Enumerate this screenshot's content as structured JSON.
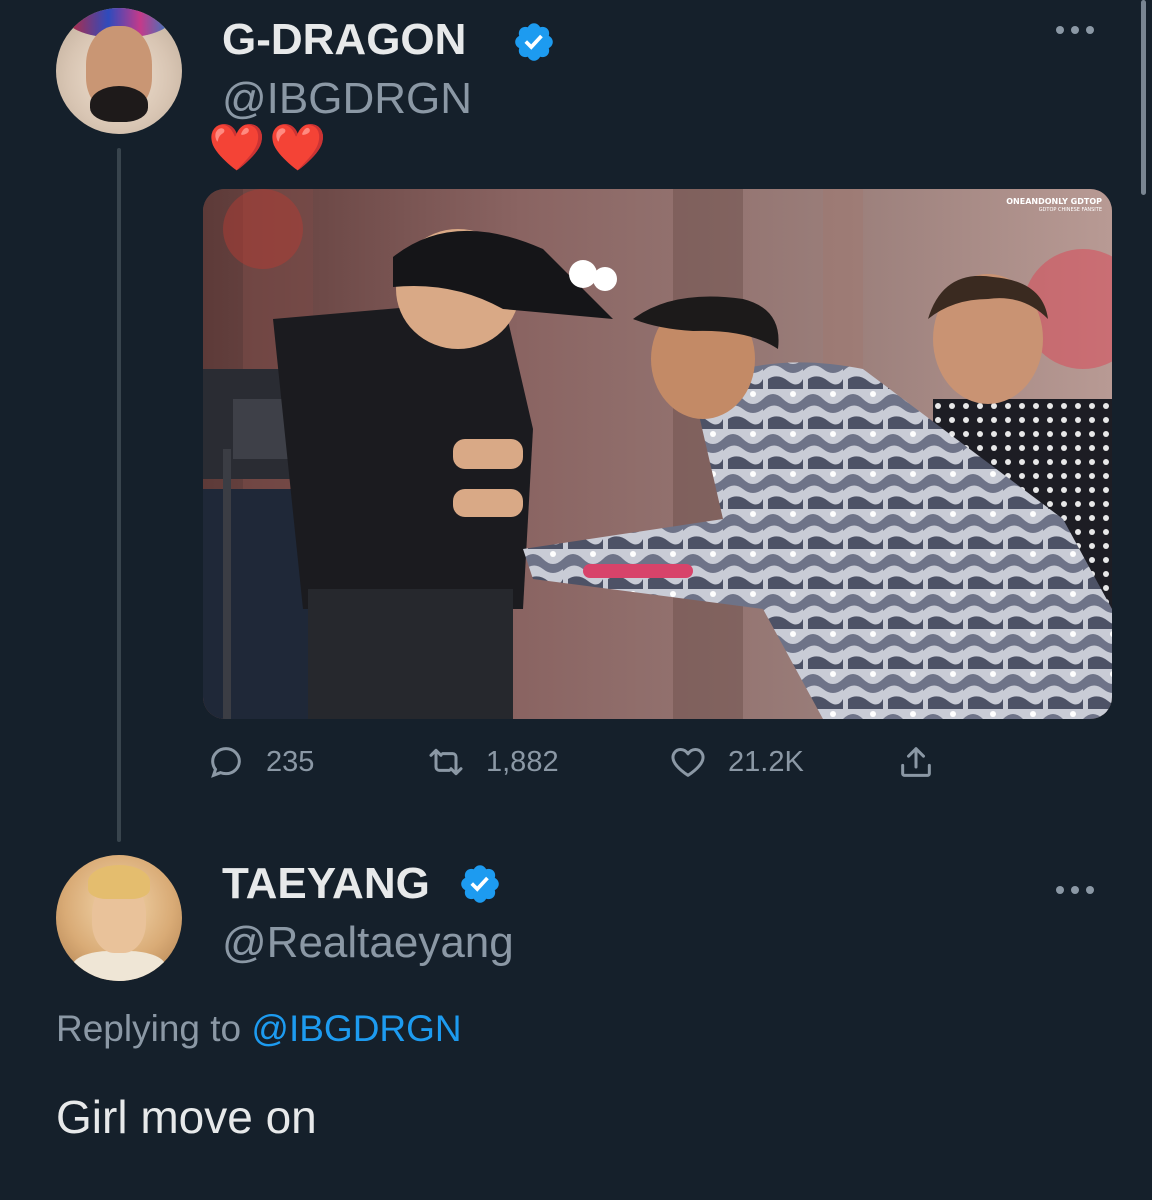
{
  "tweet": {
    "author": {
      "display_name": "G-DRAGON",
      "handle": "@IBGDRGN",
      "verified": true
    },
    "text": "❤️❤️",
    "media": {
      "watermark_line1": "ONEANDONLY GDTOP",
      "watermark_line2": "GDTOP CHINESE FANSITE"
    },
    "stats": {
      "replies": "235",
      "retweets": "1,882",
      "likes": "21.2K"
    }
  },
  "reply": {
    "author": {
      "display_name": "TAEYANG",
      "handle": "@Realtaeyang",
      "verified": true
    },
    "replying_to_label": "Replying to",
    "replying_to_handle": "@IBGDRGN",
    "text": "Girl move on"
  },
  "colors": {
    "background": "#15202b",
    "text_primary": "#e7e9ea",
    "text_secondary": "#8b98a5",
    "accent": "#1d9bf0",
    "heart": "#e0245e",
    "thread_line": "#38444d"
  },
  "icons": {
    "verified": "verified-badge-icon",
    "more": "more-horizontal-icon",
    "reply": "reply-bubble-icon",
    "retweet": "retweet-icon",
    "like": "heart-icon",
    "share": "share-upload-icon"
  }
}
